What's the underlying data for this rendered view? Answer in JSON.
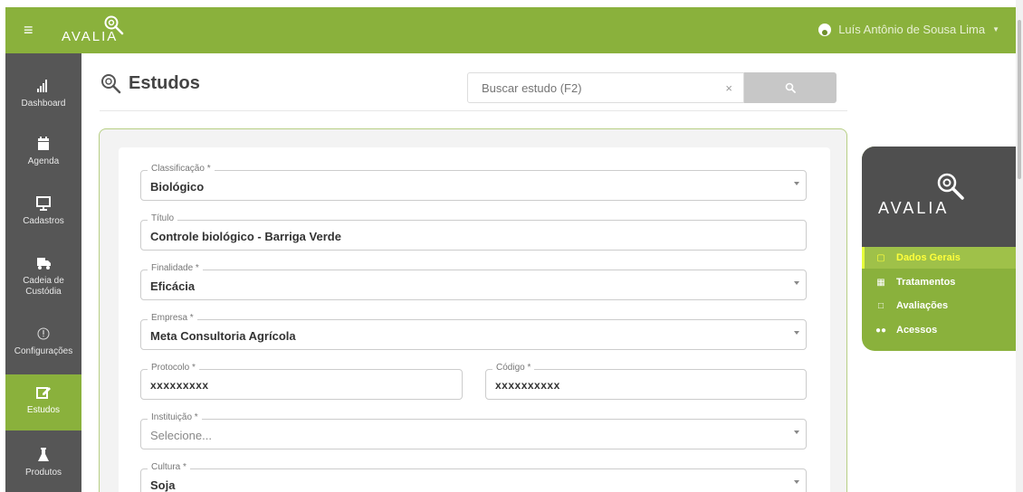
{
  "app": {
    "brand": "AVALIA"
  },
  "header": {
    "user_name": "Luís Antônio de Sousa Lima"
  },
  "sidebar": {
    "items": [
      {
        "label": "Dashboard",
        "icon": "bar-chart-icon"
      },
      {
        "label": "Agenda",
        "icon": "calendar-icon"
      },
      {
        "label": "Cadastros",
        "icon": "monitor-icon"
      },
      {
        "label": "Cadeia de Custódia",
        "icon": "truck-icon"
      },
      {
        "label": "Configurações",
        "icon": "info-circle-icon"
      },
      {
        "label": "Estudos",
        "icon": "edit-icon",
        "active": true
      },
      {
        "label": "Produtos",
        "icon": "flask-icon"
      }
    ]
  },
  "page": {
    "title": "Estudos"
  },
  "search": {
    "placeholder": "Buscar estudo (F2)",
    "clear": "×"
  },
  "form": {
    "classificacao": {
      "label": "Classificação *",
      "value": "Biológico"
    },
    "titulo": {
      "label": "Título",
      "value": "Controle biológico - Barriga Verde"
    },
    "finalidade": {
      "label": "Finalidade *",
      "value": "Eficácia"
    },
    "empresa": {
      "label": "Empresa *",
      "value": "Meta Consultoria Agrícola"
    },
    "protocolo": {
      "label": "Protocolo *",
      "value": "xxxxxxxxx"
    },
    "codigo": {
      "label": "Código *",
      "value": "xxxxxxxxxx"
    },
    "instituicao": {
      "label": "Instituição *",
      "value": "Selecione..."
    },
    "cultura": {
      "label": "Cultura *",
      "value": "Soja"
    }
  },
  "right_nav": {
    "items": [
      {
        "label": "Dados Gerais",
        "active": true
      },
      {
        "label": "Tratamentos"
      },
      {
        "label": "Avaliações"
      },
      {
        "label": "Acessos"
      }
    ]
  },
  "colors": {
    "brand_green": "#8ab13c",
    "sidebar": "#565656",
    "active_nav_text": "#ffff3b"
  }
}
